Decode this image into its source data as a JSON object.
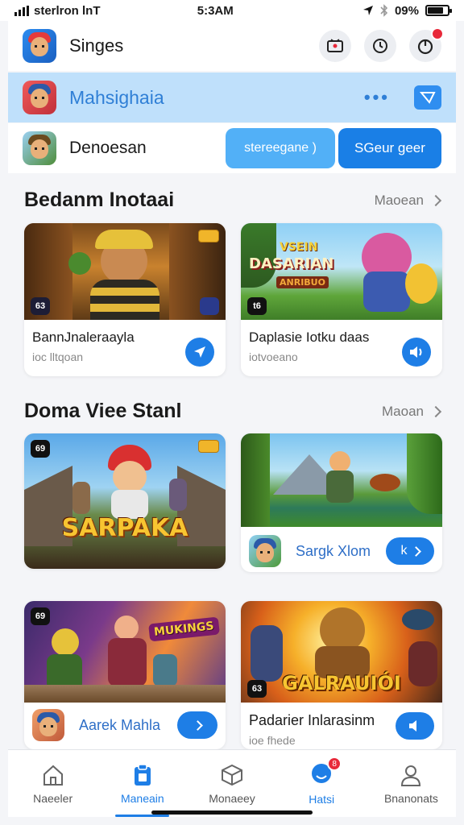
{
  "status": {
    "carrier": "sterlron lnT",
    "time": "5:3AM",
    "battery": "09%"
  },
  "header": {
    "title": "Singes"
  },
  "highlight": {
    "title": "Mahsighaia"
  },
  "third": {
    "title": "Denoesan",
    "button_light": "stereegane )",
    "button_dark": "SGeur geer"
  },
  "section1": {
    "title": "Bedanm Inotaai",
    "more": "Maoean",
    "cards": [
      {
        "title": "BannJnaleraayla",
        "subtitle": "ioc lltqoan",
        "badge": "63"
      },
      {
        "title": "Daplasie Iotku daas",
        "subtitle": "iotvoeano",
        "badge": "t6",
        "art_line1": "VSEIN",
        "art_line2": "DASARIAN",
        "art_line3": "ANRIBUO"
      }
    ]
  },
  "section2": {
    "title": "Doma Viee Stanl",
    "more": "Maoan",
    "cards": [
      {
        "badge": "69",
        "art_title": "SARPAKA"
      },
      {
        "mini_title": "Sargk Xlom",
        "button": "K"
      }
    ]
  },
  "section3": {
    "cards": [
      {
        "badge": "69",
        "art_title": "MUKINGS",
        "mini_title": "Aarek Mahla"
      },
      {
        "art_title": "GALRAUIÓI",
        "badge": "63",
        "title": "Padarier Inlarasinm",
        "subtitle": "ioe fhede"
      }
    ]
  },
  "tabs": [
    {
      "label": "Naeeler",
      "icon": "home-icon"
    },
    {
      "label": "Maneain",
      "icon": "clipboard-icon"
    },
    {
      "label": "Monaeey",
      "icon": "box-icon"
    },
    {
      "label": "Hatsi",
      "icon": "chat-icon",
      "badge": "8"
    },
    {
      "label": "Bnanonats",
      "icon": "person-icon"
    }
  ],
  "colors": {
    "accent": "#1e7ee6",
    "highlight": "#bfe0fb",
    "badge": "#e8293a"
  }
}
